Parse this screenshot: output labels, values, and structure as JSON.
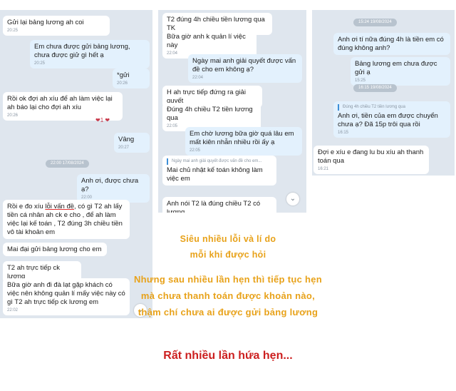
{
  "left": {
    "m1": {
      "text": "Gửi lại bảng lương ah coi",
      "time": "20:25"
    },
    "m2": {
      "text": "Em chưa được gửi bảng lương, chưa được giử gì hết ạ",
      "time": "20:25"
    },
    "m3": {
      "text": "*gửi",
      "time": "20:26"
    },
    "m4": {
      "text": "Rồi ok đợi ah xíu để ah làm việc lại ah báo lại cho đợi ah xíu",
      "time": "20:26"
    },
    "m4_reaction": "❤1 ❤",
    "m5": {
      "text": "Vâng",
      "time": "20:27"
    },
    "date": "22:00 17/08/2024",
    "m6": {
      "text": "Anh ơi, được chưa ạ?",
      "time": "22:00"
    },
    "m7": {
      "pre": "Rồi e đo xíu ",
      "underlined": "lỗi vấn đề",
      "post": ", có gì T2 ah lấy tiền cá nhân ah ck e cho , để ah làm việc lại kế toán , T2 đúng 3h chiều tiền vô tài khoản em"
    },
    "m8": {
      "text": "Mai đại gửi bảng lương cho em"
    },
    "m9": {
      "text": "T2 ah trực tiếp ck lương"
    },
    "m10": {
      "text": "Bữa giờ anh đi đà lạt gặp khách có việc nên không quản lí mấy việc này có gì T2 ah trực tiếp ck lương em",
      "time": "22:02"
    },
    "scroll": "⌄"
  },
  "middle": {
    "m1": {
      "text": "T2 đúng 4h chiều tiền lương qua TK"
    },
    "m2": {
      "text": "Bữa giờ anh k quản lí việc này",
      "time": "22:04"
    },
    "m3": {
      "text": "Ngày mai anh giải quyết được vấn đề cho em không ạ?",
      "time": "22:04"
    },
    "m4": {
      "text": "H ah trực tiếp đứng ra giải quyết"
    },
    "m5": {
      "text": "Đúng 4h chiều T2 tiền lương qua",
      "time": "22:05"
    },
    "m6": {
      "text": "Em chờ lương bữa giờ quá lâu em mất kiên nhẫn nhiều rồi ấy ạ",
      "time": "22:05"
    },
    "m7_quote": "Ngày mai anh giải quyết được vấn đề cho em...",
    "m7": {
      "text": "Mai chủ nhật kế toán không làm việc em"
    },
    "m8": {
      "text": "Anh nói T2 là đúng chiều T2 có lương"
    },
    "scroll": "⌄"
  },
  "right": {
    "date1": "15:24 19/08/2024",
    "m1": {
      "text": "Anh ơi tí nữa đúng 4h là tiền em có đúng không anh?"
    },
    "m2": {
      "text": "Bảng lương em chưa được gửi ạ",
      "time": "15:25"
    },
    "date2": "16:15 19/08/2024",
    "m3_quote": "Đúng 4h chiều T2 tiền lương qua",
    "m3": {
      "text": "Anh ơi, tiền của em được chuyển chưa ạ? Đã 15p trôi qua rồi",
      "time": "16:15"
    },
    "m4": {
      "text": "Đợi e xíu e đang lu bu xíu ah thanh toán qua",
      "time": "16:21"
    }
  },
  "caption": {
    "line1": "Siêu nhiều lỗi và lí do",
    "line2": "mỗi khi được hỏi",
    "line3": "Nhưng sau nhiều lần hẹn thì tiếp tục hẹn",
    "line4": "mà chưa thanh toán được khoản nào,",
    "line5": "thậm chí chưa ai được gửi bảng lương",
    "footer": "Rất nhiều lần hứa hẹn..."
  }
}
